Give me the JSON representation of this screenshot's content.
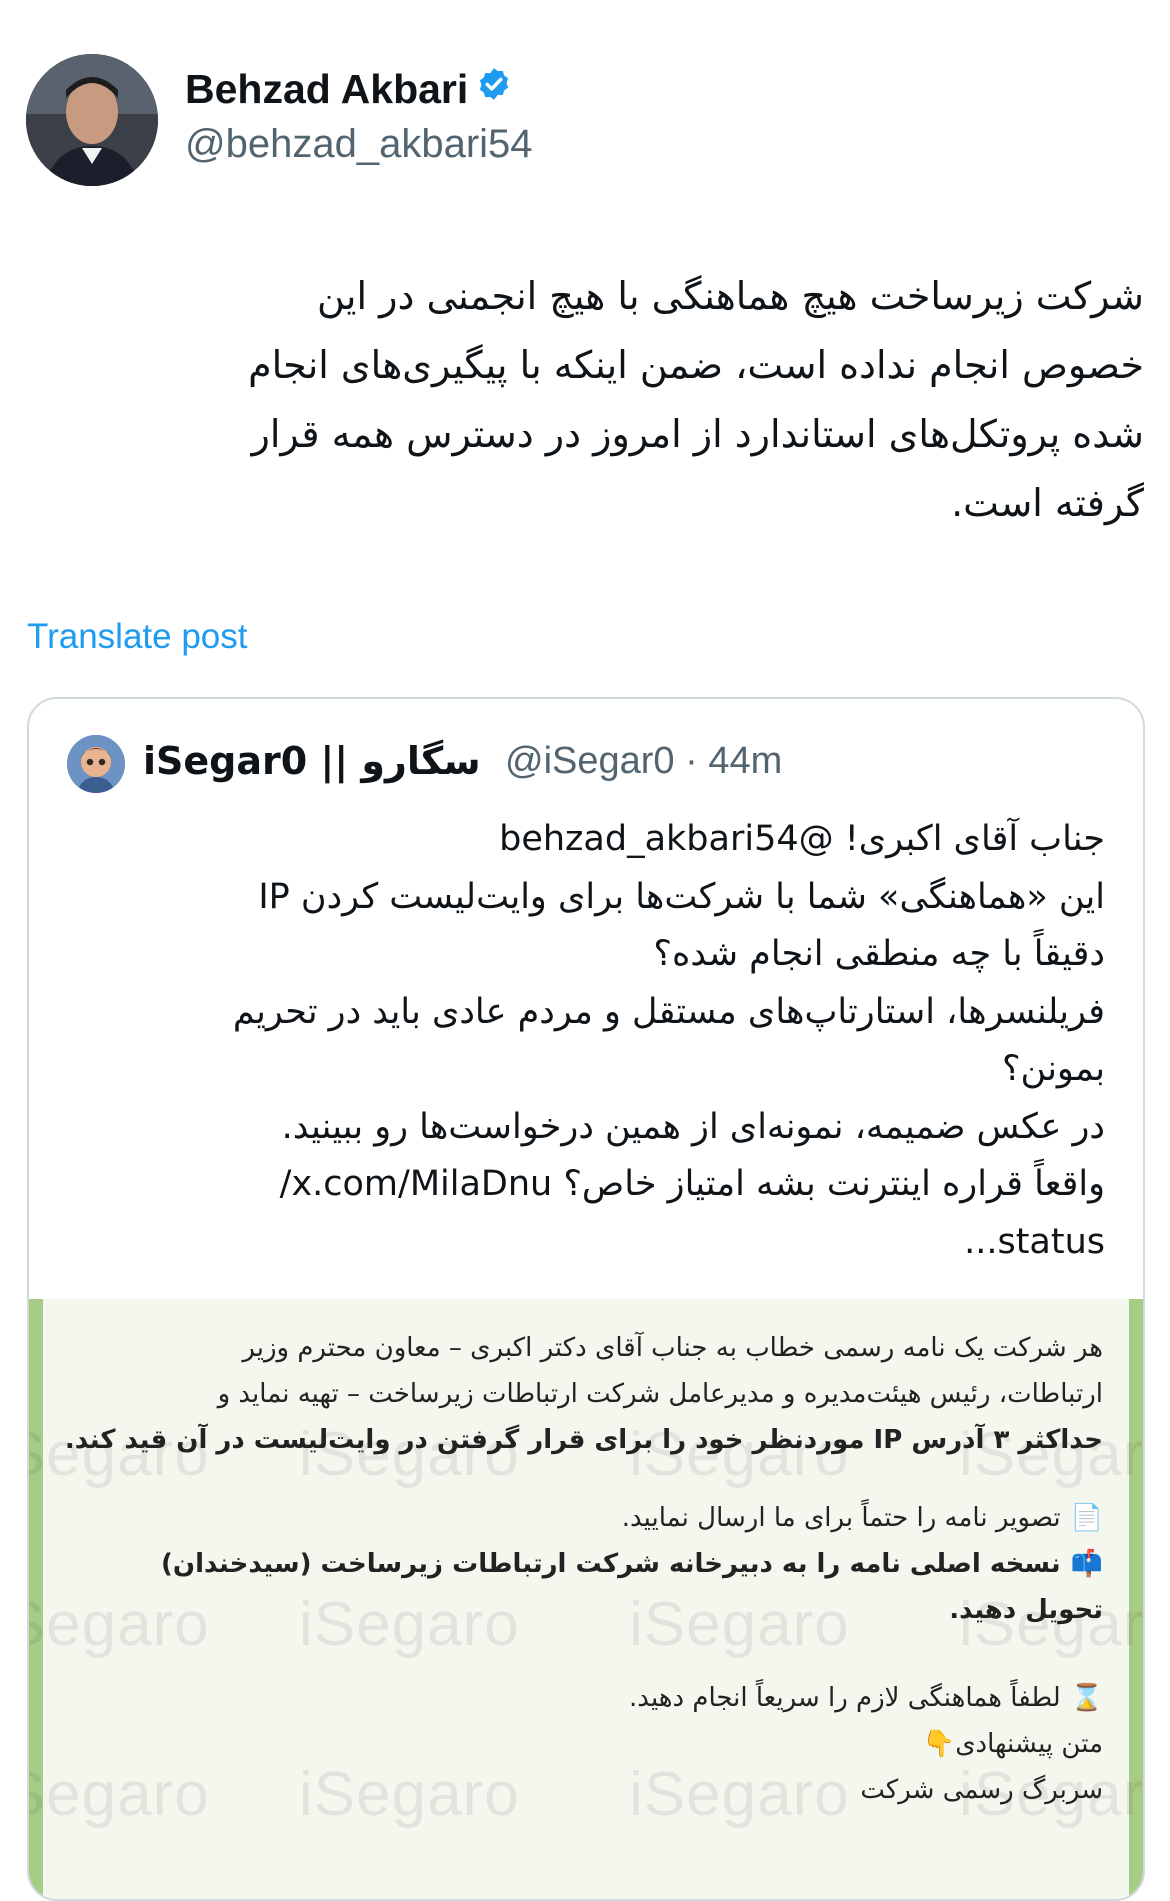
{
  "author": {
    "display_name": "Behzad Akbari",
    "handle": "@behzad_akbari54",
    "verified_icon": "verified-badge-icon",
    "verified_color": "#1d9bf0"
  },
  "post": {
    "lines": [
      "شرکت زیرساخت هیچ هماهنگی با هیچ انجمنی در این",
      "خصوص انجام نداده است، ضمن اینکه با پیگیری‌های انجام",
      "شده پروتکل‌های استاندارد از امروز در دسترس همه قرار",
      "گرفته است."
    ],
    "translate_label": "Translate post"
  },
  "quote": {
    "name": "iSegar0 || سگارو",
    "handle": "@iSegar0",
    "separator": "·",
    "time": "44m",
    "lines": [
      "جناب آقای اکبری! @behzad_akbari54",
      "این «هماهنگی» شما با شرکت‌ها برای وایت‌لیست کردن IP",
      "دقیقاً با چه منطقی انجام شده؟",
      "فریلنسرها، استارتاپ‌های مستقل و مردم عادی باید در تحریم",
      "بمونن؟",
      "در عکس ضمیمه، نمونه‌ای از همین درخواست‌ها رو ببینید.",
      "واقعاً قراره اینترنت بشه امتیاز خاص؟ x.com/MilaDnu/",
      "status..."
    ]
  },
  "media": {
    "watermark": "iSegaro",
    "p1": [
      "هر شرکت یک نامه رسمی خطاب به جناب آقای دکتر اکبری – معاون محترم وزیر",
      "ارتباطات، رئیس هیئت‌مدیره و مدیرعامل شرکت ارتباطات زیرساخت – تهیه نماید و",
      "حداکثر ۳ آدرس IP موردنظر خود را برای قرار گرفتن در وایت‌لیست در آن قید کند."
    ],
    "p2": [
      "تصویر نامه را حتماً برای ما ارسال نمایید.",
      "نسخه اصلی نامه را به دبیرخانه شرکت ارتباطات زیرساخت (سیدخندان)",
      "تحویل دهید."
    ],
    "p3": [
      "لطفاً هماهنگی لازم را سریعاً انجام دهید.",
      "متن پیشنهادی",
      "سربرگ رسمی شرکت"
    ],
    "icons": [
      "document-icon",
      "mailbox-icon",
      "hourglass-icon",
      "pointing-hand-icon"
    ]
  }
}
